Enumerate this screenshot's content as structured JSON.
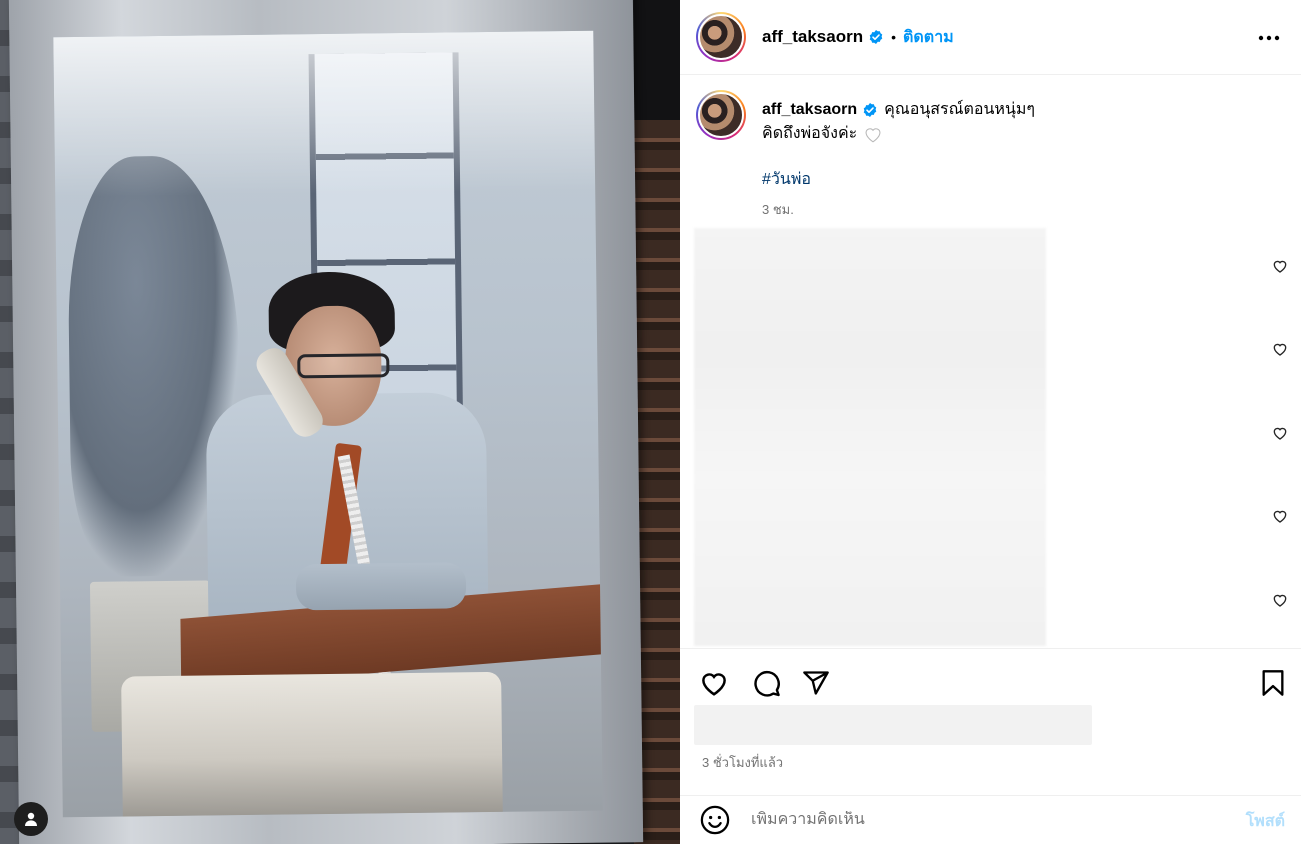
{
  "post": {
    "author": "aff_taksaorn",
    "follow_label": "ติดตาม",
    "caption_line1": "คุณอนุสรณ์ตอนหนุ่มๆ",
    "caption_line2": "คิดถึงพ่อจังค่ะ",
    "hashtag": "#วันพ่อ",
    "caption_time": "3 ชม.",
    "time_ago": "3 ชั่วโมงที่แล้ว"
  },
  "comment_box": {
    "placeholder": "เพิ่มความคิดเห็น",
    "post_label": "โพสต์"
  },
  "icons": {
    "verified": "verified-badge-icon",
    "more": "more-options-icon",
    "like": "heart-icon",
    "comment": "comment-bubble-icon",
    "share": "paper-plane-icon",
    "save": "bookmark-icon",
    "emoji": "smiley-icon",
    "profile": "user-icon"
  },
  "colors": {
    "accent": "#0095f6",
    "hashtag": "#00376b",
    "muted": "#737373",
    "post_disabled": "#b2dffc",
    "verified": "#0095f6"
  }
}
